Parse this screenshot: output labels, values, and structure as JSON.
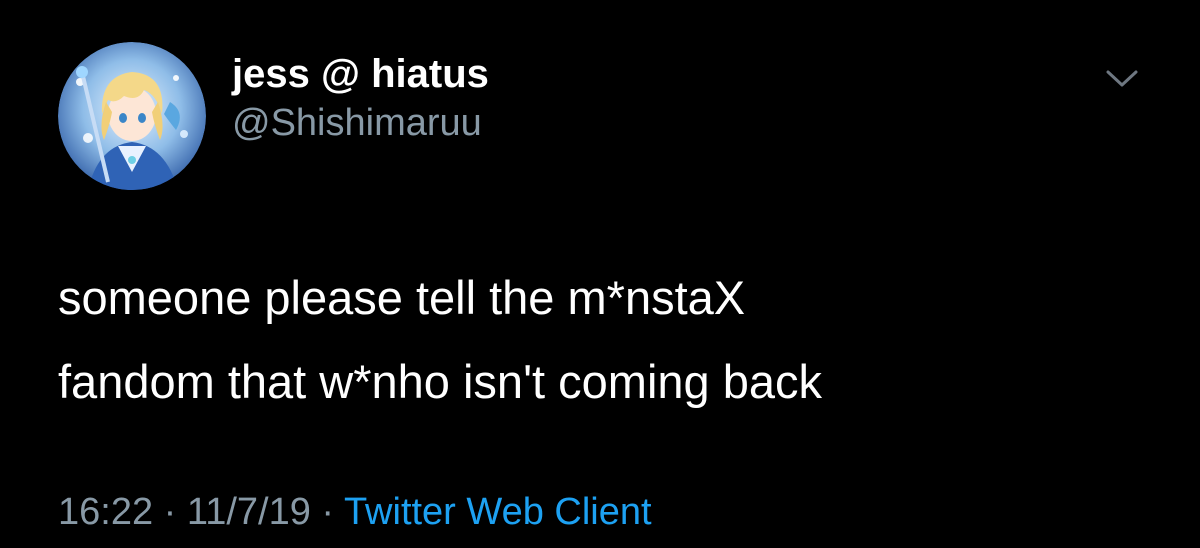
{
  "author": {
    "display_name": "jess @ hiatus",
    "handle": "@Shishimaruu",
    "avatar_icon": "anime-character-avatar"
  },
  "tweet": {
    "lines": [
      "someone please tell the m*nstaX",
      "fandom that w*nho isn't coming back"
    ]
  },
  "meta": {
    "time": "16:22",
    "separator": "·",
    "date": "11/7/19",
    "client": "Twitter Web Client"
  },
  "menu_icon": "chevron-down-icon",
  "colors": {
    "background": "#000000",
    "text": "#ffffff",
    "muted": "#8899a6",
    "link": "#1da1f2"
  }
}
